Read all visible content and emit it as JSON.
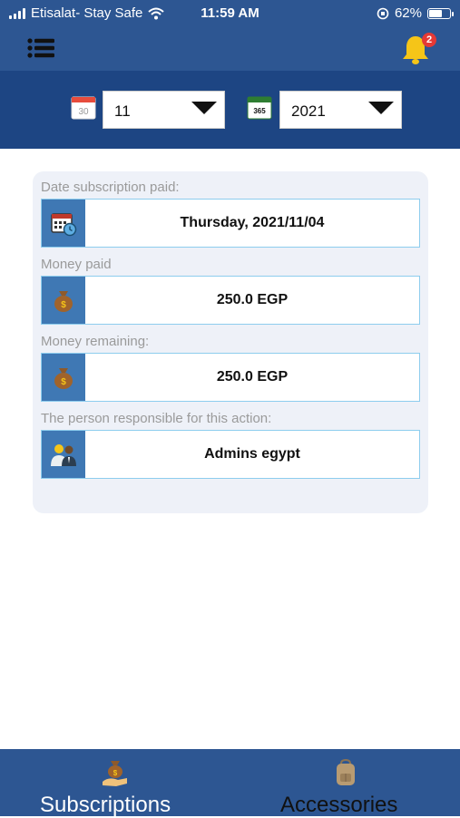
{
  "status_bar": {
    "carrier": "Etisalat- Stay Safe",
    "time": "11:59 AM",
    "battery": "62%",
    "battery_level": 0.62
  },
  "header": {
    "menu_icon": "hamburger-menu-icon",
    "notification_icon": "bell-icon",
    "notification_count": "2",
    "accent_color": "#f5c518"
  },
  "filters": {
    "month_icon": "calendar-30-icon",
    "month_value": "11",
    "year_icon": "calendar-365-icon",
    "year_value": "2021"
  },
  "details": {
    "fields": [
      {
        "label": "Date subscription paid:",
        "value": "Thursday, 2021/11/04",
        "icon": "calendar-clock-icon"
      },
      {
        "label": "Money paid",
        "value": "250.0 EGP",
        "icon": "money-bag-icon"
      },
      {
        "label": "Money remaining:",
        "value": "250.0 EGP",
        "icon": "money-bag-icon"
      },
      {
        "label": "The person responsible for this action:",
        "value": "Admins egypt",
        "icon": "people-icon"
      }
    ]
  },
  "tabs": [
    {
      "label": "Subscriptions",
      "icon": "money-hand-icon",
      "color": "#ffffff"
    },
    {
      "label": "Accessories",
      "icon": "backpack-icon",
      "color": "#111111"
    }
  ],
  "colors": {
    "header_blue": "#2d5692",
    "filter_blue": "#1d4583",
    "field_border": "#8dcdee",
    "icon_tile": "#3f78b4"
  }
}
